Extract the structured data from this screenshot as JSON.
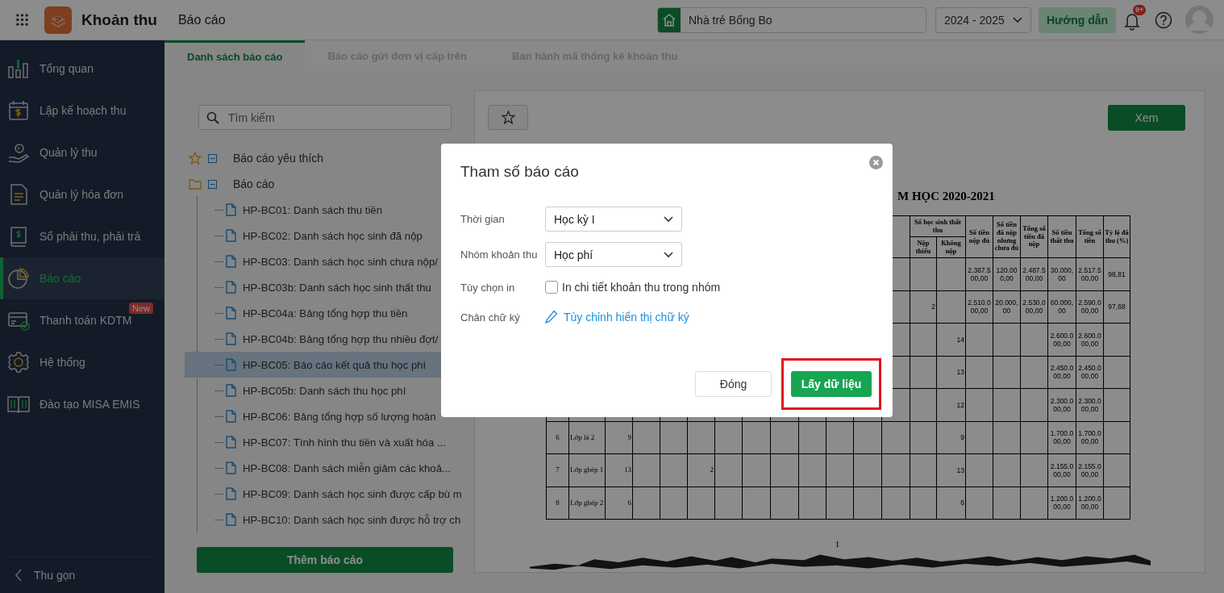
{
  "app": {
    "title": "Khoản thu",
    "section": "Báo cáo"
  },
  "header": {
    "school": "Nhà trẻ Bống Bo",
    "year": "2024 - 2025",
    "guide_button": "Hướng dẫn",
    "notification_badge": "9+"
  },
  "sidebar": {
    "items": [
      {
        "label": "Tổng quan",
        "selected": false
      },
      {
        "label": "Lập kế hoạch thu",
        "selected": false
      },
      {
        "label": "Quản lý thu",
        "selected": false
      },
      {
        "label": "Quản lý hóa đơn",
        "selected": false
      },
      {
        "label": "Sổ phải thu, phải trả",
        "selected": false
      },
      {
        "label": "Báo cáo",
        "selected": true
      },
      {
        "label": "Thanh toán KDTM",
        "selected": false,
        "badge": "New"
      },
      {
        "label": "Hệ thống",
        "selected": false
      },
      {
        "label": "Đào tạo MISA EMIS",
        "selected": false
      }
    ],
    "collapse": "Thu gọn"
  },
  "tabs": [
    {
      "label": "Danh sách báo cáo",
      "selected": true
    },
    {
      "label": "Báo cáo gửi đơn vị cấp trên",
      "selected": false
    },
    {
      "label": "Ban hành mã thống kê khoản thu",
      "selected": false
    }
  ],
  "report_list": {
    "search_placeholder": "Tìm kiếm",
    "groups": [
      {
        "label": "Báo cáo yêu thích",
        "expanded": true
      },
      {
        "label": "Báo cáo",
        "expanded": true,
        "children": [
          {
            "label": "HP-BC01: Danh sách thu tiền",
            "selected": false
          },
          {
            "label": "HP-BC02: Danh sách học sinh đã nộp",
            "selected": false
          },
          {
            "label": "HP-BC03: Danh sách học sinh chưa nộp/",
            "selected": false
          },
          {
            "label": "HP-BC03b: Danh sách học sinh thất thu",
            "selected": false
          },
          {
            "label": "HP-BC04a: Bảng tổng hợp thu tiền",
            "selected": false
          },
          {
            "label": "HP-BC04b: Bảng tổng hợp thu nhiều đợt/",
            "selected": false
          },
          {
            "label": "HP-BC05: Báo cáo kết quả thu học phí",
            "selected": true
          },
          {
            "label": "HP-BC05b: Danh sách thu học phí",
            "selected": false
          },
          {
            "label": "HP-BC06: Bảng tổng hợp số lượng hoàn",
            "selected": false
          },
          {
            "label": "HP-BC07: Tình hình thu tiền và xuất hóa ...",
            "selected": false
          },
          {
            "label": "HP-BC08: Danh sách miễn giảm các khoả...",
            "selected": false
          },
          {
            "label": "HP-BC09: Danh sách học sinh được cấp bù m",
            "selected": false
          },
          {
            "label": "HP-BC10: Danh sách học sinh được hỗ trợ ch",
            "selected": false
          }
        ]
      }
    ],
    "add_button": "Thêm báo cáo"
  },
  "preview": {
    "view_button": "Xem",
    "title": "M HỌC 2020-2021",
    "header_group": "Số học sinh thất thu",
    "columns": [
      {
        "label": "Nộp thiếu"
      },
      {
        "label": "Không nộp"
      },
      {
        "label": "Số tiền nộp đủ"
      },
      {
        "label": "Số tiền đã nộp nhưng chưa đủ"
      },
      {
        "label": "Tổng số tiền đã nộp"
      },
      {
        "label": "Số tiền thất thu"
      },
      {
        "label": "Tổng số tiền"
      },
      {
        "label": "Tỷ lệ đã thu (%)"
      }
    ],
    "rows": [
      {
        "paid_full": "2.367.500,00",
        "paid_partial": "120.000,00",
        "total_paid": "2.487.500,00",
        "lost": "30.000,00",
        "total": "2.517.500,00",
        "rate": "98,81"
      },
      {
        "underpaid": "2",
        "paid_full": "2.510.000,00",
        "paid_partial": "20.000,00",
        "total_paid": "2.530.000,00",
        "lost": "60.000,00",
        "total": "2.590.000,00",
        "rate": "97,68"
      },
      {
        "unpaid": "14",
        "lost": "2.600.000,00",
        "total": "2.600.000,00"
      },
      {
        "unpaid": "13",
        "lost": "2.450.000,00",
        "total": "2.450.000,00"
      },
      {
        "unpaid": "12",
        "lost": "2.300.000,00",
        "total": "2.300.000,00"
      },
      {
        "column_1": "6",
        "column_2": "Lớp lá 2",
        "column_3": "9",
        "unpaid": "9",
        "lost": "1.700.000,00",
        "total": "1.700.000,00"
      },
      {
        "column_1": "7",
        "column_2": "Lớp ghép 1",
        "column_3": "13",
        "column_6": "2",
        "unpaid": "13",
        "lost": "2.155.000,00",
        "total": "2.155.000,00"
      },
      {
        "column_1": "8",
        "column_2": "Lớp ghép 2",
        "column_3": "6",
        "unpaid": "6",
        "lost": "1.200.000,00",
        "total": "1.200.000,00"
      }
    ],
    "page_number": "1"
  },
  "dialog": {
    "title": "Tham số báo cáo",
    "fields": [
      {
        "kind": "select",
        "label": "Thời gian",
        "value": "Học kỳ I"
      },
      {
        "kind": "select",
        "label": "Nhóm khoản thu",
        "value": "Học phí"
      },
      {
        "kind": "checkbox",
        "label": "Tùy chọn in",
        "text": "In chi tiết khoản thu trong nhóm",
        "checked": false
      },
      {
        "kind": "link",
        "label": "Chân chữ ký",
        "text": "Tùy chỉnh hiển thị chữ ký"
      }
    ],
    "buttons": [
      {
        "label": "Đóng",
        "kind": "secondary",
        "highlighted": false
      },
      {
        "label": "Lấy dữ liệu",
        "kind": "primary",
        "highlighted": true
      }
    ]
  }
}
